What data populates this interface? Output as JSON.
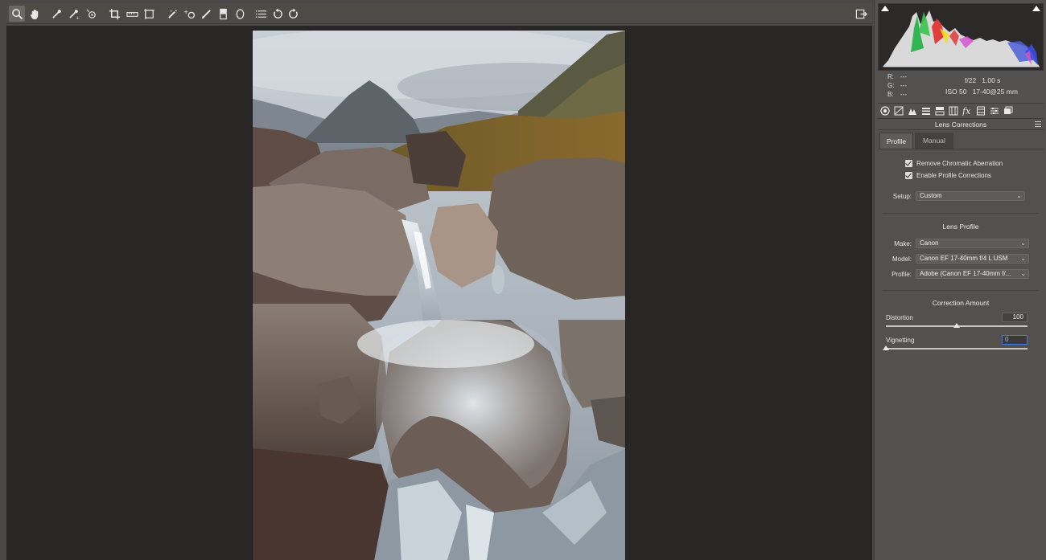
{
  "toolbar": {
    "tools": [
      {
        "name": "zoom-tool",
        "icon": "zoom-icon",
        "active": true
      },
      {
        "name": "hand-tool",
        "icon": "hand-icon"
      },
      {
        "name": "white-balance-tool",
        "icon": "eyedropper-icon"
      },
      {
        "name": "color-sampler-tool",
        "icon": "color-sampler-icon"
      },
      {
        "name": "targeted-adjustment-tool",
        "icon": "target-adjust-icon"
      },
      {
        "name": "crop-tool",
        "icon": "crop-icon"
      },
      {
        "name": "straighten-tool",
        "icon": "ruler-icon"
      },
      {
        "name": "transform-tool",
        "icon": "transform-icon"
      },
      {
        "name": "spot-removal-tool",
        "icon": "spot-removal-icon"
      },
      {
        "name": "red-eye-tool",
        "icon": "red-eye-icon"
      },
      {
        "name": "adjustment-brush-tool",
        "icon": "brush-icon"
      },
      {
        "name": "graduated-filter-tool",
        "icon": "graduated-filter-icon"
      },
      {
        "name": "radial-filter-tool",
        "icon": "radial-filter-icon"
      },
      {
        "name": "preferences-tool",
        "icon": "list-icon"
      },
      {
        "name": "rotate-ccw-tool",
        "icon": "rotate-ccw-icon"
      },
      {
        "name": "rotate-cw-tool",
        "icon": "rotate-cw-icon"
      }
    ],
    "fullscreen_icon": "fullscreen-icon"
  },
  "readout": {
    "r_label": "R:",
    "r_value": "---",
    "g_label": "G:",
    "g_value": "---",
    "b_label": "B:",
    "b_value": "---",
    "aperture": "f/22",
    "shutter": "1.00 s",
    "iso": "ISO 50",
    "lens_focal": "17-40@25 mm"
  },
  "panel_tabs": [
    "basic-icon",
    "tone-curve-icon",
    "detail-icon",
    "hsl-icon",
    "split-toning-icon",
    "lens-corrections-icon",
    "fx-icon",
    "camera-calibration-icon",
    "presets-icon",
    "snapshots-icon"
  ],
  "section": {
    "title": "Lens Corrections"
  },
  "subtabs": {
    "profile": "Profile",
    "manual": "Manual"
  },
  "checks": {
    "remove_ca": "Remove Chromatic Aberration",
    "enable_profile": "Enable Profile Corrections"
  },
  "setup": {
    "label": "Setup:",
    "value": "Custom"
  },
  "lens_profile": {
    "title": "Lens Profile",
    "make_label": "Make:",
    "make_value": "Canon",
    "model_label": "Model:",
    "model_value": "Canon EF 17-40mm f/4 L USM",
    "profile_label": "Profile:",
    "profile_value": "Adobe (Canon EF 17-40mm f/..."
  },
  "correction_amount": {
    "title": "Correction Amount",
    "distortion_label": "Distortion",
    "distortion_value": "100",
    "vignetting_label": "Vignetting",
    "vignetting_value": "0"
  },
  "colors": {
    "canvas_bg": "#282725",
    "panel_bg": "#535150",
    "accent_focus": "#3d7be0"
  }
}
